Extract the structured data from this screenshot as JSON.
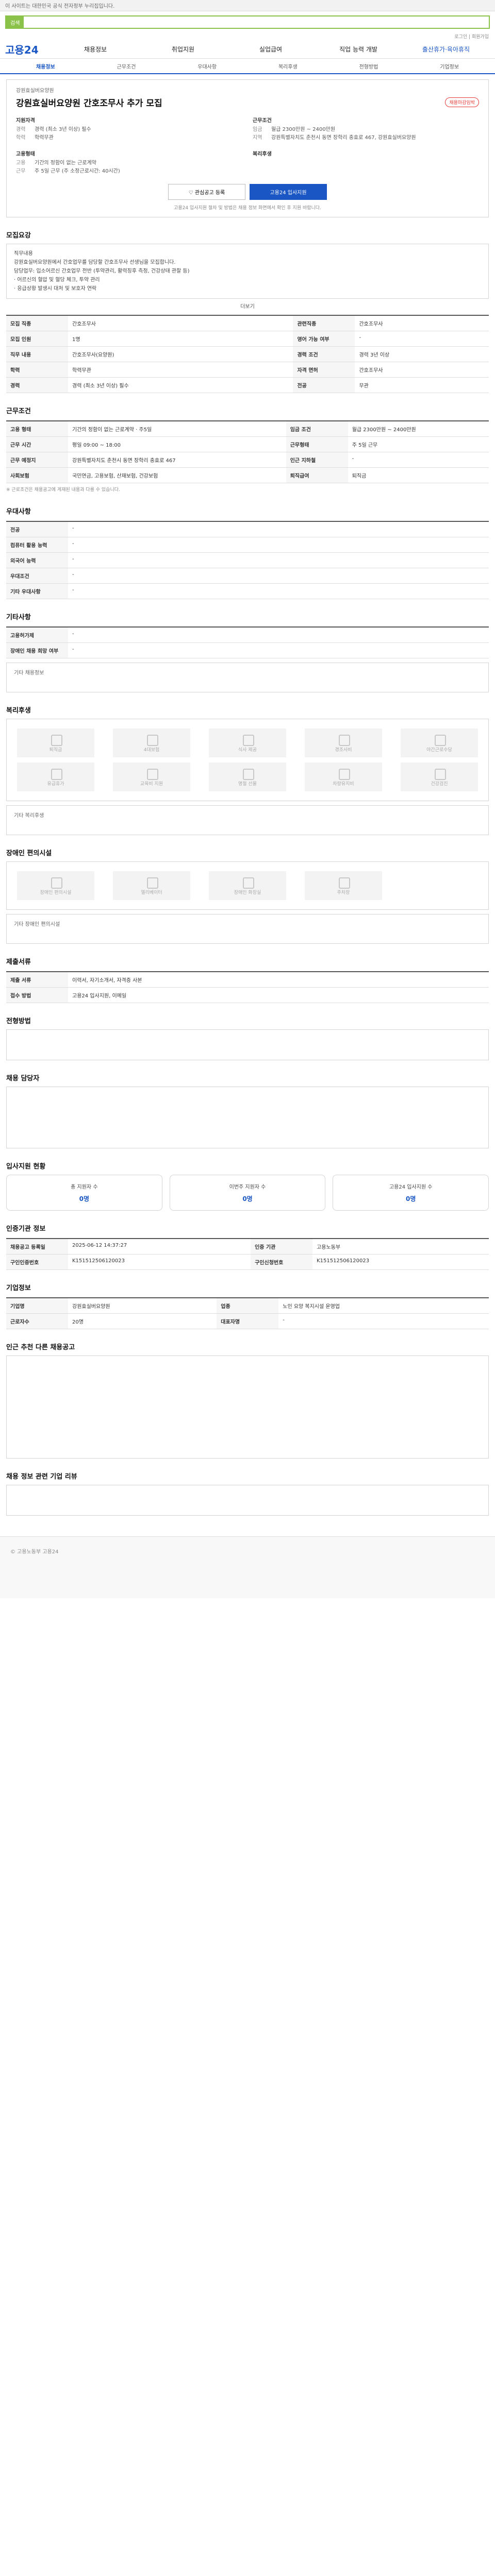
{
  "top": {
    "notice": "이 사이트는 대한민국 공식 전자정부 누리집입니다.",
    "search_badge": "검색",
    "search_placeholder": "",
    "util_links": "로그인 | 회원가입"
  },
  "gnb": {
    "logo": "고용24",
    "items": [
      "채용정보",
      "취업지원",
      "실업급여",
      "직업 능력 개발",
      "출산휴가·육아휴직"
    ]
  },
  "tabs": [
    "채용정보",
    "근무조건",
    "우대사항",
    "복리후생",
    "전형방법",
    "기업정보"
  ],
  "job": {
    "company": "강원효실버요양원",
    "title": "강원효실버요양원 간호조무사 추가 모집",
    "status_pill": "채용마감임박",
    "qual_label": "지원자격",
    "qual": [
      {
        "k": "경력",
        "v": "경력 (최소 3년 이상) 필수"
      },
      {
        "k": "학력",
        "v": "학력무관"
      }
    ],
    "cond_label": "근무조건",
    "cond": [
      {
        "k": "임금",
        "v": "월급 2300만원 ~ 2400만원"
      },
      {
        "k": "지역",
        "v": "강원특별자치도 춘천시 동면 장학리 충효로 467, 강원효실버요양원"
      }
    ],
    "type_label": "고용형태",
    "type": [
      {
        "k": "고용",
        "v": "기간의 정함이 없는 근로계약"
      },
      {
        "k": "근무",
        "v": "주 5일 근무 (주 소정근로시간: 40시간)"
      }
    ],
    "welfare_label": "복리후생",
    "btn_scrap": "관심공고 등록",
    "btn_apply": "고용24 입사지원",
    "btn_note": "고용24 입사지원 절차 및 방법은 채용 정보 화면에서 확인 후 지원 바랍니다."
  },
  "sections": {
    "recruit": "모집요강",
    "cond": "근무조건",
    "pref": "우대사항",
    "etc": "기타사항",
    "welfare": "복리후생",
    "disabled": "장애인 편의시설",
    "docs": "제출서류",
    "process": "전형방법",
    "contact": "채용 담당자",
    "stats": "입사지원 현황",
    "info": "인증기관 정보",
    "company": "기업정보",
    "similar": "인근 추천 다른 채용공고",
    "reviews": "채용 정보 관련 기업 리뷰"
  },
  "recruit": {
    "text": "직무내용\n강원효실버요양원에서 간호업무를 담당할 간호조무사 선생님을 모집합니다.\n담당업무: 입소어르신 간호업무 전반 (투약관리, 활력징후 측정, 건강상태 관찰 등)\n· 어르신의 혈압 및 혈당 체크, 투약 관리\n· 응급상황 발생시 대처 및 보호자 연락",
    "more": "더보기",
    "rows": [
      [
        "모집 직종",
        "간호조무사",
        "관련직종",
        "간호조무사"
      ],
      [
        "모집 인원",
        "1명",
        "영어 가능 여부",
        "-"
      ],
      [
        "직무 내용",
        "간호조무사(요양원)",
        "경력 조건",
        "경력 3년 이상"
      ],
      [
        "학력",
        "학력무관",
        "자격 면허",
        "간호조무사"
      ],
      [
        "경력",
        "경력 (최소 3년 이상) 필수",
        "전공",
        "무관"
      ]
    ]
  },
  "cond": {
    "rows": [
      [
        "고용 형태",
        "기간의 정함이 없는 근로계약 · 주5일",
        "임금 조건",
        "월급 2300만원 ~ 2400만원"
      ],
      [
        "근무 시간",
        "평일 09:00 ~ 18:00",
        "근무형태",
        "주 5일 근무"
      ],
      [
        "근무 예정지",
        "강원특별자치도 춘천시 동면 장학리 충효로 467",
        "인근 지하철",
        "-"
      ],
      [
        "사회보험",
        "국민연금, 고용보험, 산재보험, 건강보험",
        "퇴직급여",
        "퇴직금"
      ]
    ],
    "note": "※ 근로조건은 채용공고에 게재된 내용과 다를 수 있습니다."
  },
  "pref": {
    "rows": [
      [
        "전공",
        "-"
      ],
      [
        "컴퓨터 활용 능력",
        "-"
      ],
      [
        "외국어 능력",
        "-"
      ],
      [
        "우대조건",
        "-"
      ],
      [
        "기타 우대사항",
        "-"
      ]
    ]
  },
  "etc": {
    "rows": [
      [
        "고용허가제",
        "-"
      ],
      [
        "장애인 채용 희망 여부",
        "-"
      ]
    ],
    "more_label": "기타 채용정보"
  },
  "welfare": {
    "items": [
      "퇴직금",
      "4대보험",
      "식사 제공",
      "경조사비",
      "야간근로수당",
      "유급휴가",
      "교육비 지원",
      "명절 선물",
      "차량유지비",
      "건강검진"
    ],
    "empty": "기타 복리후생"
  },
  "disabled": {
    "items": [
      "장애인 편의시설",
      "엘리베이터",
      "장애인 화장실",
      "주차장"
    ],
    "empty": "기타 장애인 편의시설"
  },
  "docs": {
    "rows": [
      [
        "제출 서류",
        "이력서, 자기소개서, 자격증 사본"
      ],
      [
        "접수 방법",
        "고용24 입사지원, 이메일"
      ]
    ]
  },
  "stats": [
    {
      "t": "총 지원자 수",
      "n": "0명"
    },
    {
      "t": "이번주 지원자 수",
      "n": "0명"
    },
    {
      "t": "고용24 입사지원 수",
      "n": "0명"
    }
  ],
  "info": {
    "rows": [
      [
        "채용공고 등록일",
        "2025-06-12 14:37:27",
        "인증 기관",
        "고용노동부"
      ],
      [
        "구인인증번호",
        "K151512506120023",
        "구인신청번호",
        "K151512506120023"
      ]
    ]
  },
  "company": {
    "rows": [
      [
        "기업명",
        "강원효실버요양원",
        "업종",
        "노인 요양 복지시설 운영업"
      ],
      [
        "근로자수",
        "20명",
        "대표자명",
        "-"
      ]
    ]
  },
  "footer": "© 고용노동부 고용24"
}
